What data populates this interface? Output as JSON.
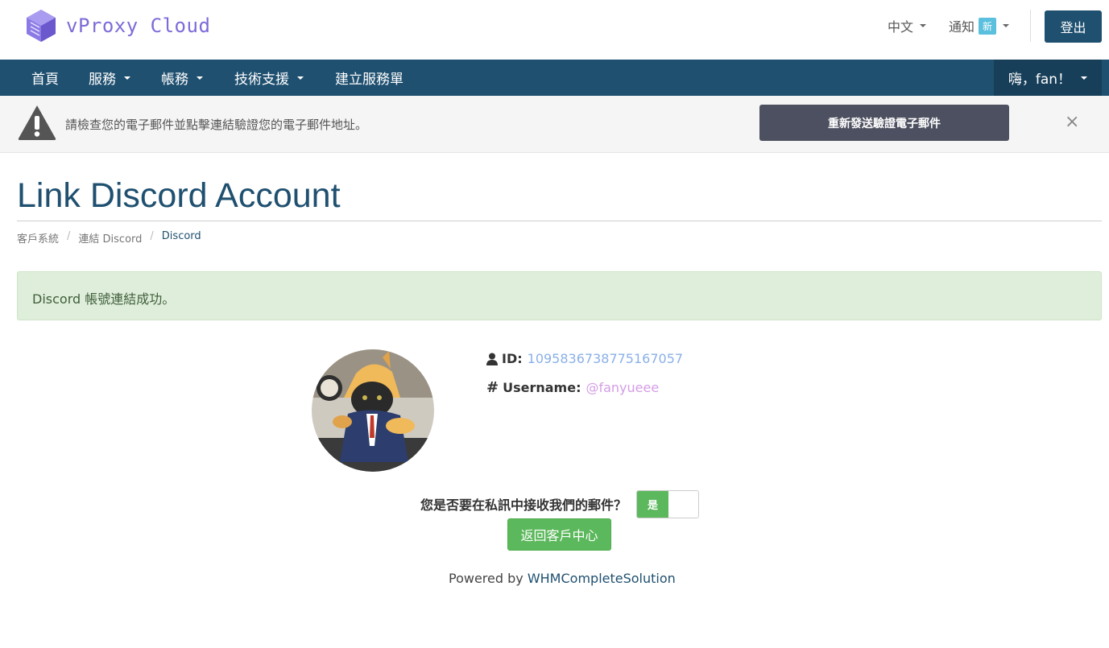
{
  "header": {
    "logo_text": "vProxy Cloud",
    "language": "中文",
    "notifications": "通知",
    "notifications_badge": "新",
    "logout": "登出"
  },
  "nav": {
    "items": [
      {
        "label": "首頁"
      },
      {
        "label": "服務"
      },
      {
        "label": "帳務"
      },
      {
        "label": "技術支援"
      },
      {
        "label": "建立服務單"
      }
    ],
    "user_greeting": "嗨，fan！"
  },
  "verify_bar": {
    "message": "請檢查您的電子郵件並點擊連結驗證您的電子郵件地址。",
    "resend_button": "重新發送驗證電子郵件",
    "close": "×"
  },
  "page": {
    "title": "Link Discord Account",
    "breadcrumb": [
      "客戶系統",
      "連結 Discord",
      "Discord"
    ]
  },
  "alert": {
    "text": "Discord 帳號連結成功。"
  },
  "profile": {
    "id_label": "ID:",
    "id_value": "1095836738775167057",
    "username_label": "Username:",
    "username_value": "@fanyueee"
  },
  "dm_question": {
    "text": "您是否要在私訊中接收我們的郵件？",
    "toggle_value": "是"
  },
  "return_button": "返回客戶中心",
  "footer": {
    "powered_prefix": "Powered by",
    "powered_link": "WHMCompleteSolution"
  },
  "colors": {
    "brand_navy": "#1f5070",
    "success_green": "#5cb85c",
    "logo_purple": "#7d6bd8"
  }
}
